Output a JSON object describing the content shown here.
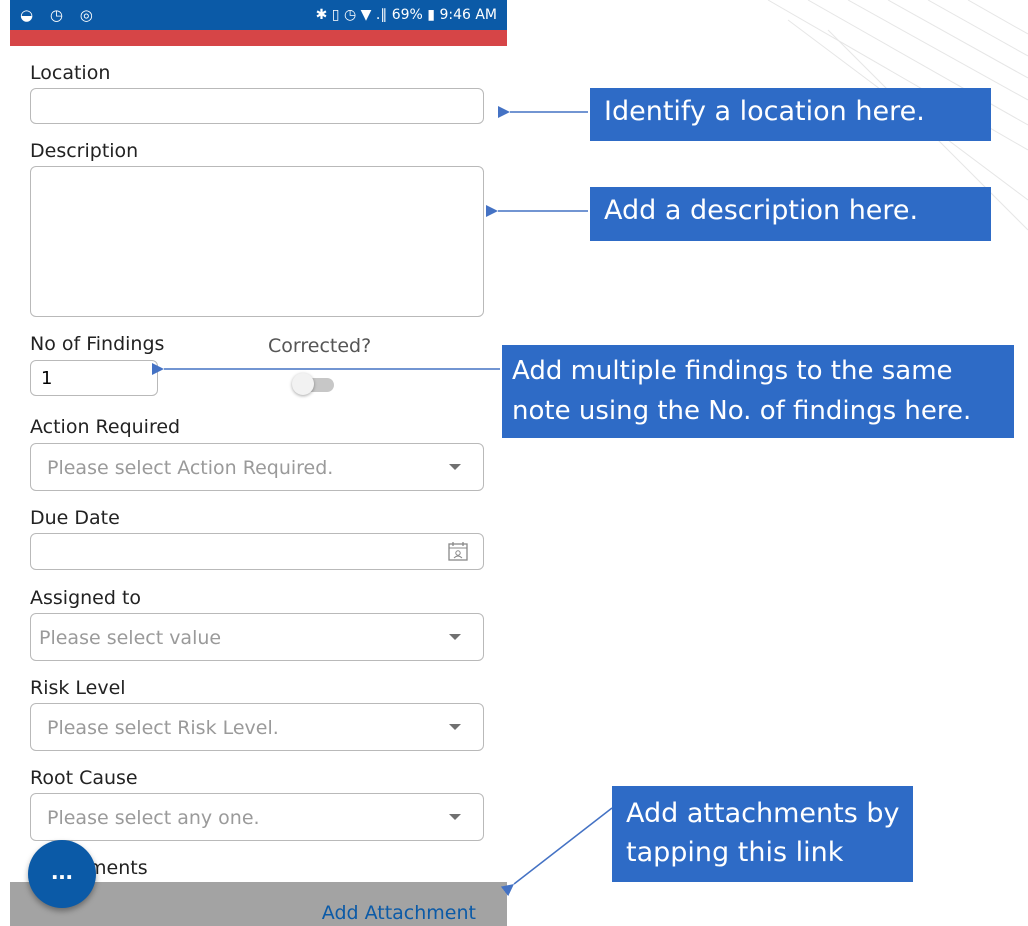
{
  "status_bar": {
    "left_icons": [
      "wifi-icon",
      "alarm-icon",
      "sync-icon"
    ],
    "right_text": "✱ ▯ ◷ ▼ .∥ 69% ▮ 9:46 AM",
    "battery": "69%",
    "time": "9:46 AM"
  },
  "form": {
    "location_label": "Location",
    "location_value": "",
    "description_label": "Description",
    "description_value": "",
    "findings_label": "No of Findings",
    "findings_value": "1",
    "corrected_label": "Corrected?",
    "corrected_on": false,
    "action_label": "Action Required",
    "action_placeholder": "Please select Action Required.",
    "due_label": "Due Date",
    "due_value": "",
    "assigned_label": "Assigned to",
    "assigned_placeholder": "Please select value",
    "risk_label": "Risk Level",
    "risk_placeholder": "Please select Risk Level.",
    "root_label": "Root Cause",
    "root_placeholder": "Please select any one.",
    "attachments_label_visible": "ments",
    "add_attachment_label": "Add Attachment",
    "fab_label": "..."
  },
  "callouts": {
    "location": "Identify a location here.",
    "description": "Add a description here.",
    "findings": "Add multiple findings to the same note using the No. of findings here.",
    "attachments": "Add attachments by tapping this link"
  },
  "colors": {
    "header_blue": "#0b5aa7",
    "accent_red": "#d64547",
    "callout_blue": "#2e6bc6",
    "arrow_blue": "#4472c4"
  }
}
